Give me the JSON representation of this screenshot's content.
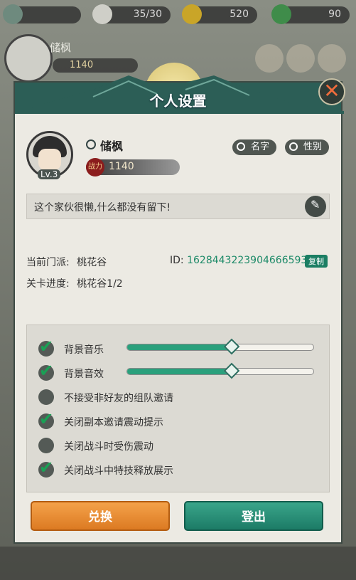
{
  "hud": {
    "stat1": "",
    "stamina": "35/30",
    "gold": "520",
    "jade": "90"
  },
  "player_top": {
    "name": "储枫",
    "power": "1140"
  },
  "dialog": {
    "title": "个人设置",
    "profile": {
      "level": "Lv.3",
      "name": "储枫",
      "power_badge": "战力",
      "power": "1140",
      "name_button": "名字",
      "gender_button": "性别"
    },
    "signature": "这个家伙很懒,什么都没有留下!",
    "sect_label": "当前门派:",
    "sect_value": "桃花谷",
    "id_label": "ID:",
    "id_value": "1628443223904666593",
    "copy_button": "复制",
    "stage_label": "关卡进度:",
    "stage_value": "桃花谷1/2",
    "settings": [
      {
        "label": "背景音乐",
        "checked": true,
        "slider": 0.56
      },
      {
        "label": "背景音效",
        "checked": true,
        "slider": 0.56
      },
      {
        "label": "不接受非好友的组队邀请",
        "checked": false
      },
      {
        "label": "关闭副本邀请震动提示",
        "checked": true
      },
      {
        "label": "关闭战斗时受伤震动",
        "checked": false
      },
      {
        "label": "关闭战斗中特技释放展示",
        "checked": true
      }
    ],
    "exchange_button": "兑换",
    "logout_button": "登出"
  }
}
